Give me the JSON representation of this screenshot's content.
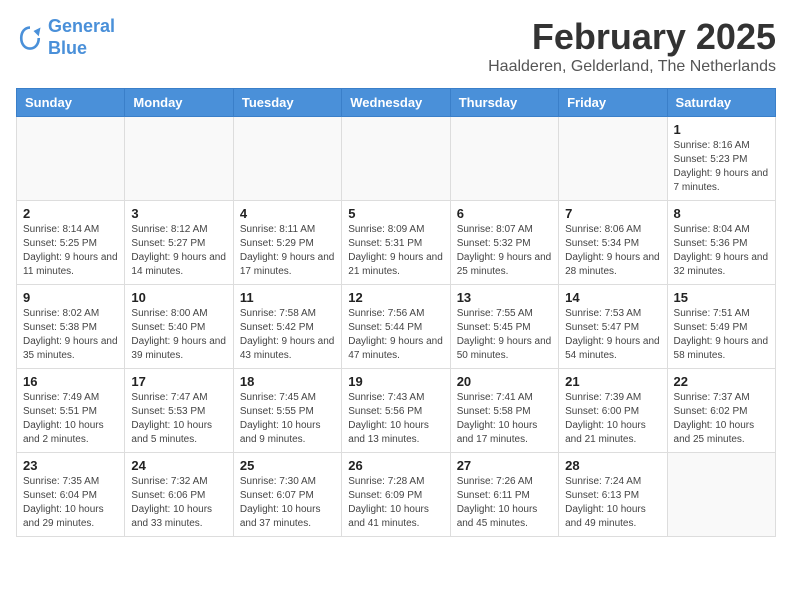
{
  "logo": {
    "line1": "General",
    "line2": "Blue"
  },
  "title": "February 2025",
  "location": "Haalderen, Gelderland, The Netherlands",
  "weekdays": [
    "Sunday",
    "Monday",
    "Tuesday",
    "Wednesday",
    "Thursday",
    "Friday",
    "Saturday"
  ],
  "days": [
    {
      "date": "",
      "info": ""
    },
    {
      "date": "",
      "info": ""
    },
    {
      "date": "",
      "info": ""
    },
    {
      "date": "",
      "info": ""
    },
    {
      "date": "",
      "info": ""
    },
    {
      "date": "",
      "info": ""
    },
    {
      "date": "1",
      "info": "Sunrise: 8:16 AM\nSunset: 5:23 PM\nDaylight: 9 hours and 7 minutes."
    },
    {
      "date": "2",
      "info": "Sunrise: 8:14 AM\nSunset: 5:25 PM\nDaylight: 9 hours and 11 minutes."
    },
    {
      "date": "3",
      "info": "Sunrise: 8:12 AM\nSunset: 5:27 PM\nDaylight: 9 hours and 14 minutes."
    },
    {
      "date": "4",
      "info": "Sunrise: 8:11 AM\nSunset: 5:29 PM\nDaylight: 9 hours and 17 minutes."
    },
    {
      "date": "5",
      "info": "Sunrise: 8:09 AM\nSunset: 5:31 PM\nDaylight: 9 hours and 21 minutes."
    },
    {
      "date": "6",
      "info": "Sunrise: 8:07 AM\nSunset: 5:32 PM\nDaylight: 9 hours and 25 minutes."
    },
    {
      "date": "7",
      "info": "Sunrise: 8:06 AM\nSunset: 5:34 PM\nDaylight: 9 hours and 28 minutes."
    },
    {
      "date": "8",
      "info": "Sunrise: 8:04 AM\nSunset: 5:36 PM\nDaylight: 9 hours and 32 minutes."
    },
    {
      "date": "9",
      "info": "Sunrise: 8:02 AM\nSunset: 5:38 PM\nDaylight: 9 hours and 35 minutes."
    },
    {
      "date": "10",
      "info": "Sunrise: 8:00 AM\nSunset: 5:40 PM\nDaylight: 9 hours and 39 minutes."
    },
    {
      "date": "11",
      "info": "Sunrise: 7:58 AM\nSunset: 5:42 PM\nDaylight: 9 hours and 43 minutes."
    },
    {
      "date": "12",
      "info": "Sunrise: 7:56 AM\nSunset: 5:44 PM\nDaylight: 9 hours and 47 minutes."
    },
    {
      "date": "13",
      "info": "Sunrise: 7:55 AM\nSunset: 5:45 PM\nDaylight: 9 hours and 50 minutes."
    },
    {
      "date": "14",
      "info": "Sunrise: 7:53 AM\nSunset: 5:47 PM\nDaylight: 9 hours and 54 minutes."
    },
    {
      "date": "15",
      "info": "Sunrise: 7:51 AM\nSunset: 5:49 PM\nDaylight: 9 hours and 58 minutes."
    },
    {
      "date": "16",
      "info": "Sunrise: 7:49 AM\nSunset: 5:51 PM\nDaylight: 10 hours and 2 minutes."
    },
    {
      "date": "17",
      "info": "Sunrise: 7:47 AM\nSunset: 5:53 PM\nDaylight: 10 hours and 5 minutes."
    },
    {
      "date": "18",
      "info": "Sunrise: 7:45 AM\nSunset: 5:55 PM\nDaylight: 10 hours and 9 minutes."
    },
    {
      "date": "19",
      "info": "Sunrise: 7:43 AM\nSunset: 5:56 PM\nDaylight: 10 hours and 13 minutes."
    },
    {
      "date": "20",
      "info": "Sunrise: 7:41 AM\nSunset: 5:58 PM\nDaylight: 10 hours and 17 minutes."
    },
    {
      "date": "21",
      "info": "Sunrise: 7:39 AM\nSunset: 6:00 PM\nDaylight: 10 hours and 21 minutes."
    },
    {
      "date": "22",
      "info": "Sunrise: 7:37 AM\nSunset: 6:02 PM\nDaylight: 10 hours and 25 minutes."
    },
    {
      "date": "23",
      "info": "Sunrise: 7:35 AM\nSunset: 6:04 PM\nDaylight: 10 hours and 29 minutes."
    },
    {
      "date": "24",
      "info": "Sunrise: 7:32 AM\nSunset: 6:06 PM\nDaylight: 10 hours and 33 minutes."
    },
    {
      "date": "25",
      "info": "Sunrise: 7:30 AM\nSunset: 6:07 PM\nDaylight: 10 hours and 37 minutes."
    },
    {
      "date": "26",
      "info": "Sunrise: 7:28 AM\nSunset: 6:09 PM\nDaylight: 10 hours and 41 minutes."
    },
    {
      "date": "27",
      "info": "Sunrise: 7:26 AM\nSunset: 6:11 PM\nDaylight: 10 hours and 45 minutes."
    },
    {
      "date": "28",
      "info": "Sunrise: 7:24 AM\nSunset: 6:13 PM\nDaylight: 10 hours and 49 minutes."
    },
    {
      "date": "",
      "info": ""
    }
  ]
}
